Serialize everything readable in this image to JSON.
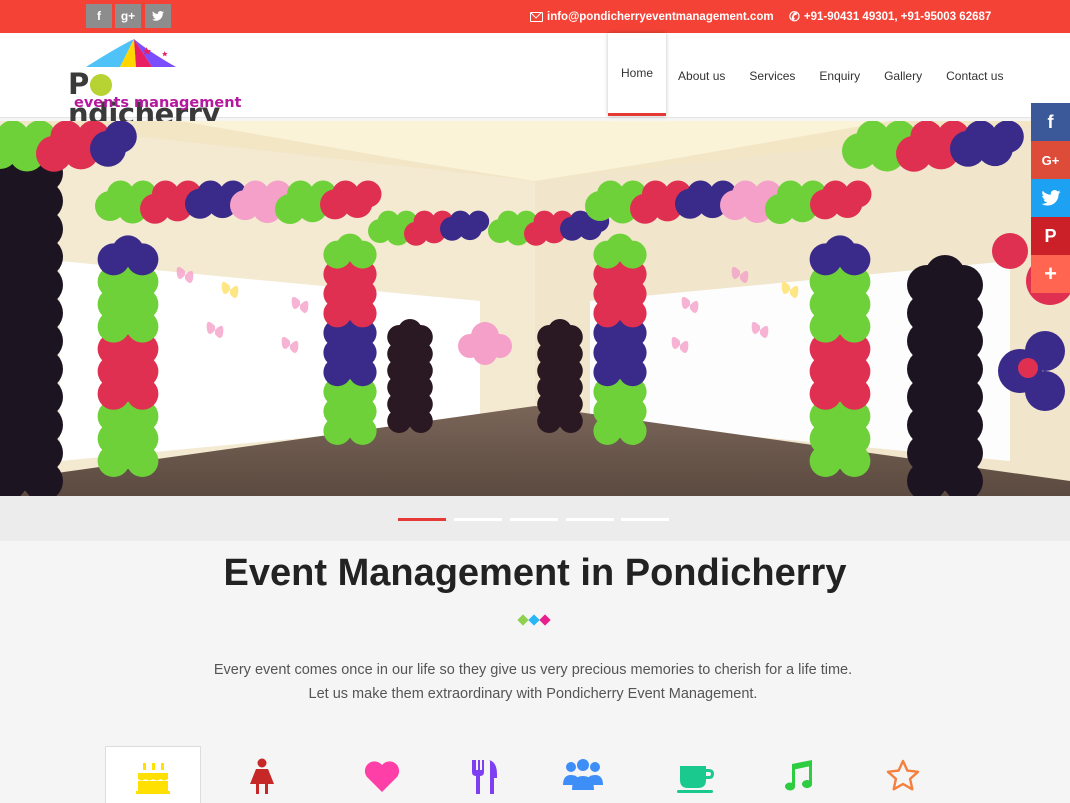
{
  "topbar": {
    "social": [
      {
        "icon": "facebook-icon",
        "glyph": "f"
      },
      {
        "icon": "google-plus-icon",
        "glyph": "g+"
      },
      {
        "icon": "twitter-icon",
        "glyph": "t"
      }
    ],
    "email": "info@pondicherryeventmanagement.com",
    "phone": "+91-90431 49301, +91-95003 62687"
  },
  "logo": {
    "title_before": "P",
    "title_after": "ndicherry",
    "subtitle": "events management"
  },
  "nav": {
    "items": [
      "Home",
      "About us",
      "Services",
      "Enquiry",
      "Gallery",
      "Contact us"
    ],
    "active": "Home"
  },
  "side_share": [
    {
      "icon": "facebook-icon",
      "glyph": "f",
      "color": "#3b5998"
    },
    {
      "icon": "google-plus-icon",
      "glyph": "G+",
      "color": "#dd4b39"
    },
    {
      "icon": "twitter-icon",
      "glyph": "🐦",
      "color": "#1da1f2"
    },
    {
      "icon": "pinterest-icon",
      "glyph": "P",
      "color": "#cb2027"
    },
    {
      "icon": "share-more-icon",
      "glyph": "+",
      "color": "#ff6550"
    }
  ],
  "slider": {
    "slide_count": 5,
    "active_index": 0
  },
  "intro": {
    "title": "Event Management in Pondicherry",
    "line1": "Every event comes once in our life so they give us very precious memories to cherish for a life time.",
    "line2": "Let us make them extraordinary with Pondicherry Event Management."
  },
  "services": [
    {
      "icon": "birthday-cake-icon",
      "color": "#ffe000"
    },
    {
      "icon": "female-icon",
      "color": "#c62828"
    },
    {
      "icon": "heart-icon",
      "color": "#ff3fa8"
    },
    {
      "icon": "cutlery-icon",
      "color": "#7e3ff2"
    },
    {
      "icon": "users-icon",
      "color": "#3e8ef7"
    },
    {
      "icon": "coffee-icon",
      "color": "#1ac98e"
    },
    {
      "icon": "music-icon",
      "color": "#2ecc40"
    },
    {
      "icon": "star-icon",
      "color": "#f57f3d"
    }
  ],
  "colors": {
    "accent": "#f44336",
    "active_indicator": "#e53935"
  }
}
